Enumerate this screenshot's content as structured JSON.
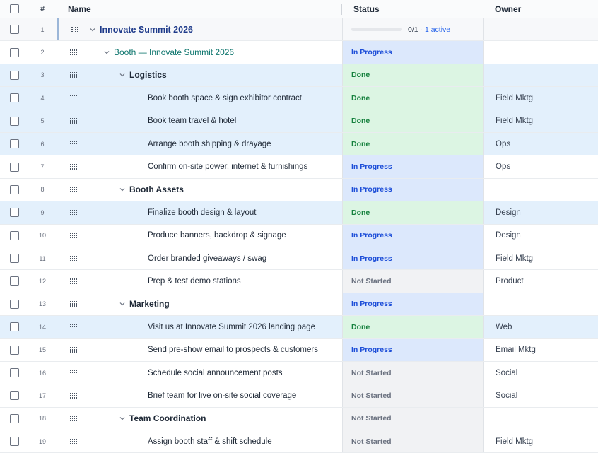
{
  "header": {
    "num": "#",
    "name": "Name",
    "status": "Status",
    "owner": "Owner"
  },
  "project": {
    "num": "1",
    "name": "Innovate Summit 2026",
    "progress_fraction": 0,
    "progress_text": "0/1",
    "progress_sep": "·",
    "active_text": "1 active"
  },
  "rows": [
    {
      "num": "2",
      "name": "Booth — Innovate Summit 2026",
      "level": 1,
      "expandable": true,
      "status": "In Progress",
      "status_kind": "prog",
      "owner": "",
      "selected": false
    },
    {
      "num": "3",
      "name": "Logistics",
      "level": 2,
      "expandable": true,
      "status": "Done",
      "status_kind": "done",
      "owner": "",
      "selected": true
    },
    {
      "num": "4",
      "name": "Book booth space & sign exhibitor contract",
      "level": 3,
      "expandable": false,
      "status": "Done",
      "status_kind": "done",
      "owner": "Field Mktg",
      "selected": true
    },
    {
      "num": "5",
      "name": "Book team travel & hotel",
      "level": 3,
      "expandable": false,
      "status": "Done",
      "status_kind": "done",
      "owner": "Field Mktg",
      "selected": true
    },
    {
      "num": "6",
      "name": "Arrange booth shipping & drayage",
      "level": 3,
      "expandable": false,
      "status": "Done",
      "status_kind": "done",
      "owner": "Ops",
      "selected": true
    },
    {
      "num": "7",
      "name": "Confirm on-site power, internet & furnishings",
      "level": 3,
      "expandable": false,
      "status": "In Progress",
      "status_kind": "prog",
      "owner": "Ops",
      "selected": false
    },
    {
      "num": "8",
      "name": "Booth Assets",
      "level": 2,
      "expandable": true,
      "status": "In Progress",
      "status_kind": "prog",
      "owner": "",
      "selected": false
    },
    {
      "num": "9",
      "name": "Finalize booth design & layout",
      "level": 3,
      "expandable": false,
      "status": "Done",
      "status_kind": "done",
      "owner": "Design",
      "selected": true
    },
    {
      "num": "10",
      "name": "Produce banners, backdrop & signage",
      "level": 3,
      "expandable": false,
      "status": "In Progress",
      "status_kind": "prog",
      "owner": "Design",
      "selected": false
    },
    {
      "num": "11",
      "name": "Order branded giveaways / swag",
      "level": 3,
      "expandable": false,
      "status": "In Progress",
      "status_kind": "prog",
      "owner": "Field Mktg",
      "selected": false
    },
    {
      "num": "12",
      "name": "Prep & test demo stations",
      "level": 3,
      "expandable": false,
      "status": "Not Started",
      "status_kind": "none",
      "owner": "Product",
      "selected": false
    },
    {
      "num": "13",
      "name": "Marketing",
      "level": 2,
      "expandable": true,
      "status": "In Progress",
      "status_kind": "prog",
      "owner": "",
      "selected": false
    },
    {
      "num": "14",
      "name": "Visit us at Innovate Summit 2026 landing page",
      "level": 3,
      "expandable": false,
      "status": "Done",
      "status_kind": "done",
      "owner": "Web",
      "selected": true
    },
    {
      "num": "15",
      "name": "Send pre-show email to prospects & customers",
      "level": 3,
      "expandable": false,
      "status": "In Progress",
      "status_kind": "prog",
      "owner": "Email Mktg",
      "selected": false
    },
    {
      "num": "16",
      "name": "Schedule social announcement posts",
      "level": 3,
      "expandable": false,
      "status": "Not Started",
      "status_kind": "none",
      "owner": "Social",
      "selected": false
    },
    {
      "num": "17",
      "name": "Brief team for live on-site social coverage",
      "level": 3,
      "expandable": false,
      "status": "Not Started",
      "status_kind": "none",
      "owner": "Social",
      "selected": false
    },
    {
      "num": "18",
      "name": "Team Coordination",
      "level": 2,
      "expandable": true,
      "status": "Not Started",
      "status_kind": "none",
      "owner": "",
      "selected": false
    },
    {
      "num": "19",
      "name": "Assign booth staff & shift schedule",
      "level": 3,
      "expandable": false,
      "status": "Not Started",
      "status_kind": "none",
      "owner": "Field Mktg",
      "selected": false
    }
  ],
  "icons": {
    "checkbox": "checkbox-icon",
    "drag": "drag-handle-icon",
    "expand": "chevron-down-icon"
  },
  "colors": {
    "done_bg": "#dcf5e3",
    "done_text": "#15803d",
    "progress_bg": "#dce8fc",
    "progress_text": "#1d4ed8",
    "not_started_bg": "#f1f2f4",
    "selected_row": "#e3f0fc"
  }
}
